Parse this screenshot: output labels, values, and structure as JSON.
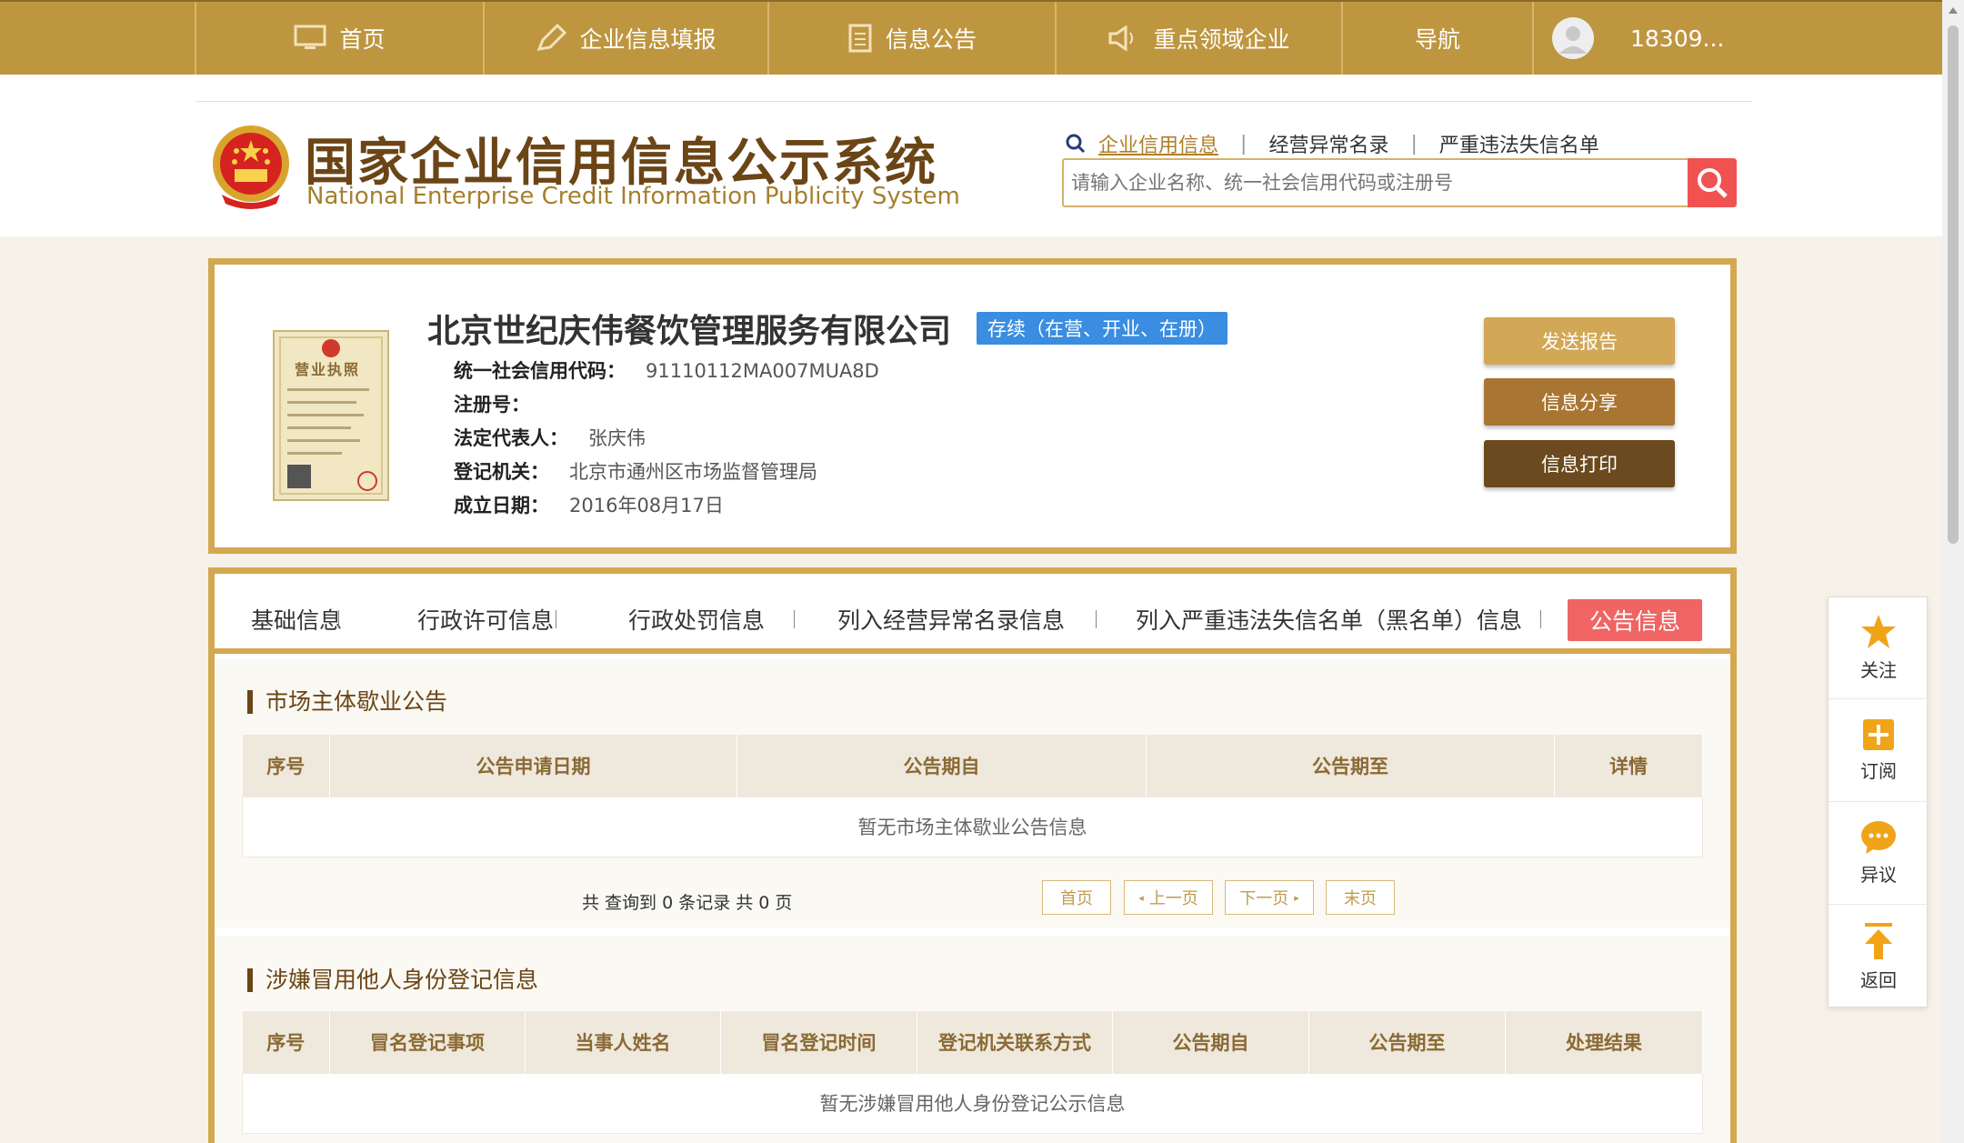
{
  "nav": {
    "home": "首页",
    "fill": "企业信息填报",
    "notice": "信息公告",
    "key_enterprise": "重点领域企业",
    "guide": "导航",
    "user": "18309..."
  },
  "header": {
    "title": "国家企业信用信息公示系统",
    "subtitle": "National Enterprise Credit Information Publicity System",
    "search_tabs": [
      "企业信用信息",
      "经营异常名录",
      "严重违法失信名单"
    ],
    "search_placeholder": "请输入企业名称、统一社会信用代码或注册号"
  },
  "company": {
    "name": "北京世纪庆伟餐饮管理服务有限公司",
    "status": "存续（在营、开业、在册）",
    "license_label": "营业执照",
    "fields": [
      {
        "label": "统一社会信用代码：",
        "value": "91110112MA007MUA8D"
      },
      {
        "label": "注册号：",
        "value": ""
      },
      {
        "label": "法定代表人：",
        "value": "张庆伟"
      },
      {
        "label": "登记机关：",
        "value": "北京市通州区市场监督管理局"
      },
      {
        "label": "成立日期：",
        "value": "2016年08月17日"
      }
    ],
    "actions": [
      "发送报告",
      "信息分享",
      "信息打印"
    ]
  },
  "tabs": [
    "基础信息",
    "行政许可信息",
    "行政处罚信息",
    "列入经营异常名录信息",
    "列入严重违法失信名单（黑名单）信息",
    "公告信息"
  ],
  "section1": {
    "title": "市场主体歇业公告",
    "headers": [
      "序号",
      "公告申请日期",
      "公告期自",
      "公告期至",
      "详情"
    ],
    "empty": "暂无市场主体歇业公告信息",
    "pager_text": "共 查询到 0 条记录 共 0 页",
    "pager": [
      "首页",
      "上一页",
      "下一页",
      "末页"
    ]
  },
  "section2": {
    "title": "涉嫌冒用他人身份登记信息",
    "headers": [
      "序号",
      "冒名登记事项",
      "当事人姓名",
      "冒名登记时间",
      "登记机关联系方式",
      "公告期自",
      "公告期至",
      "处理结果"
    ],
    "empty": "暂无涉嫌冒用他人身份登记公示信息"
  },
  "float": [
    "关注",
    "订阅",
    "异议",
    "返回"
  ],
  "colors": {
    "gold": "#be9640",
    "brown": "#6b4516",
    "accent_red": "#f06464",
    "status_blue": "#3a8de0"
  }
}
